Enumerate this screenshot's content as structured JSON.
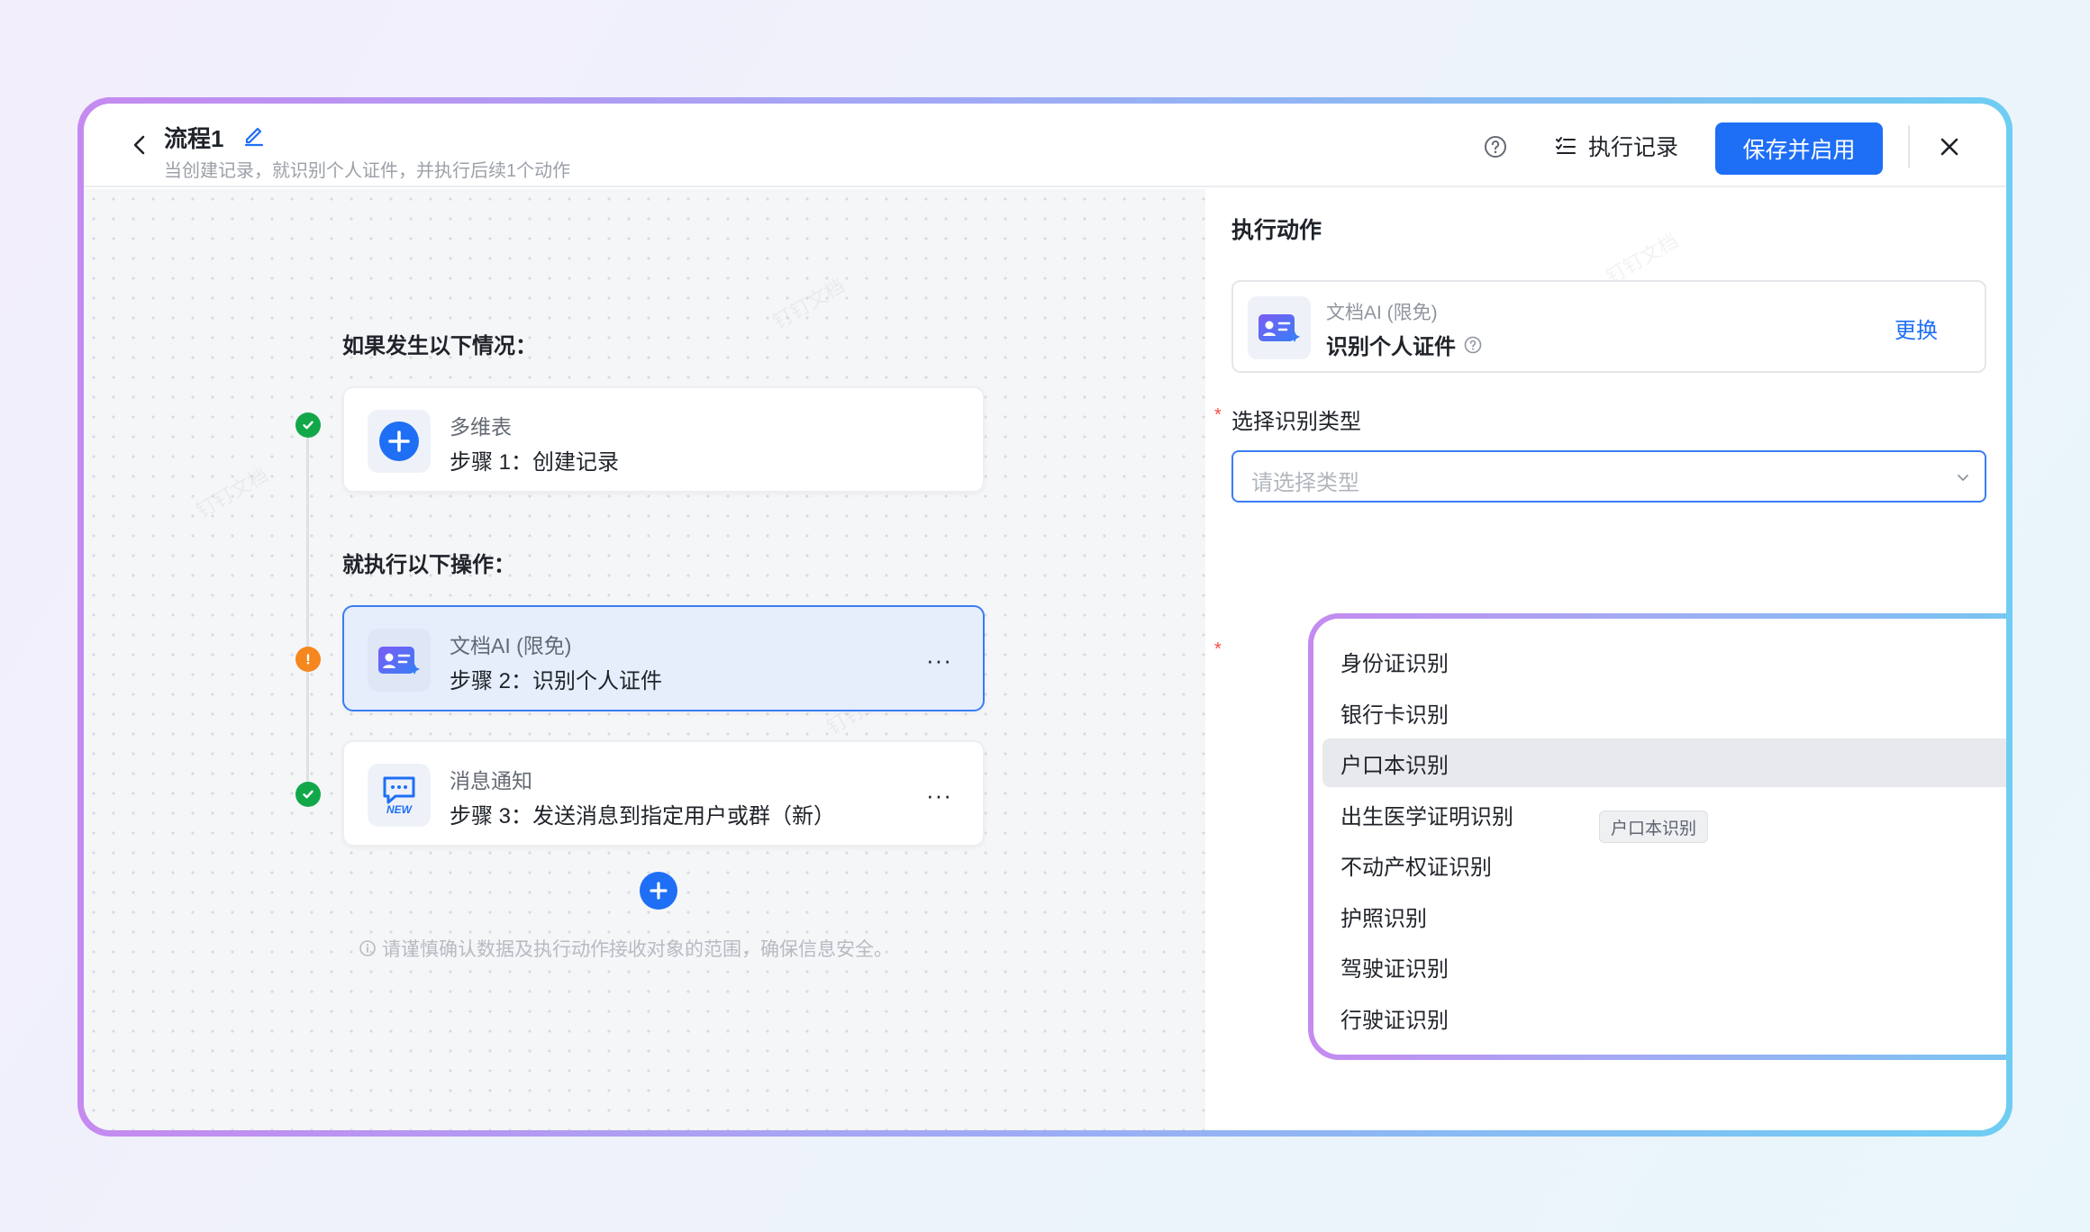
{
  "header": {
    "title": "流程1",
    "subtitle": "当创建记录，就识别个人证件，并执行后续1个动作",
    "exec_log": "执行记录",
    "save": "保存并启用"
  },
  "canvas": {
    "trigger_heading": "如果发生以下情况：",
    "action_heading": "就执行以下操作：",
    "steps": [
      {
        "category": "多维表",
        "step": "步骤 1：创建记录",
        "status": "success"
      },
      {
        "category": "文档AI (限免)",
        "step": "步骤 2：识别个人证件",
        "status": "warning",
        "more": "···"
      },
      {
        "category": "消息通知",
        "step": "步骤 3：发送消息到指定用户或群（新）",
        "status": "success",
        "badge": "NEW",
        "more": "···"
      }
    ],
    "hint": "请谨慎确认数据及执行动作接收对象的范围，确保信息安全。"
  },
  "panel": {
    "title": "执行动作",
    "action_category": "文档AI (限免)",
    "action_name": "识别个人证件",
    "change": "更换",
    "field_label": "选择识别类型",
    "placeholder": "请选择类型",
    "options": [
      "身份证识别",
      "银行卡识别",
      "户口本识别",
      "出生医学证明识别",
      "不动产权证识别",
      "护照识别",
      "驾驶证识别",
      "行驶证识别"
    ],
    "hovered_option": "户口本识别",
    "tooltip": "户口本识别"
  },
  "colors": {
    "primary": "#1e6ff5",
    "success": "#12a84a",
    "warning": "#f5871f",
    "frame_gradient": [
      "#c58af0",
      "#6fcdf2"
    ]
  },
  "watermark": "钉钉文档"
}
